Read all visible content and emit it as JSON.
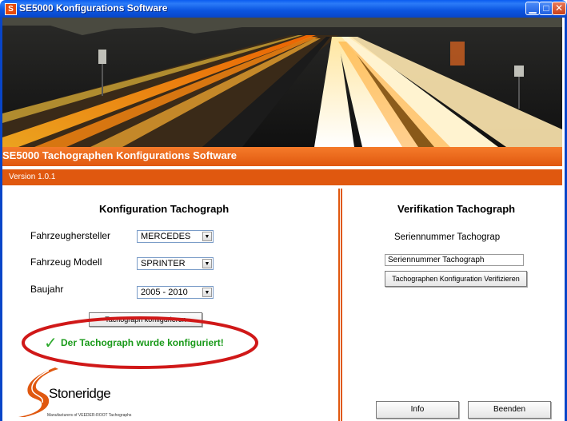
{
  "window": {
    "title": "SE5000 Konfigurations Software",
    "icon_letter": "S",
    "buttons": [
      "minimize-icon",
      "maximize-icon",
      "close-icon"
    ]
  },
  "header": {
    "heading": "SE5000 Tachographen Konfigurations Software",
    "version": "Version  1.0.1"
  },
  "config": {
    "title": "Konfiguration Tachograph",
    "manufacturer_label": "Fahrzeughersteller",
    "manufacturer_value": "MERCEDES",
    "model_label": "Fahrzeug Modell",
    "model_value": "SPRINTER",
    "year_label": "Baujahr",
    "year_value": "2005 - 2010",
    "configure_button": "Tachograph konfigurieren",
    "success_message": "Der Tachograph wurde konfiguriert!"
  },
  "verify": {
    "title": "Verifikation Tachograph",
    "serial_label": "Seriennummer Tachograp",
    "serial_value": "Seriennummer Tachograph",
    "verify_button": "Tachographen Konfiguration Verifizieren"
  },
  "footer": {
    "info_button": "Info",
    "exit_button": "Beenden"
  },
  "logo": {
    "name": "Stoneridge",
    "tagline": "Manufacturers of VEEDER-ROOT Tachographs"
  },
  "colors": {
    "accent_orange": "#e0580f",
    "titlebar_blue": "#0845c8",
    "success_green": "#1a9a1a",
    "highlight_red": "#d01818"
  }
}
